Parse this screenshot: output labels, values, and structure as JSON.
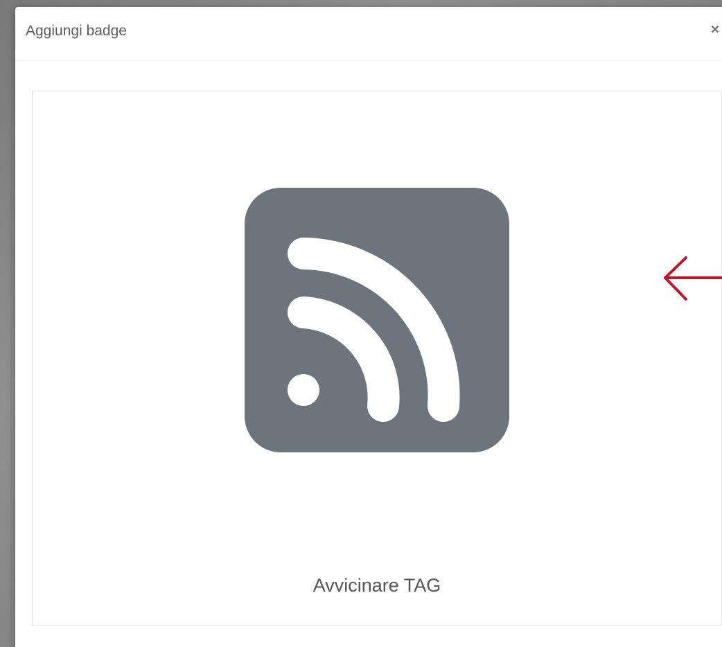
{
  "dialog": {
    "title": "Aggiungi badge",
    "close_label": "×"
  },
  "reader": {
    "icon": "rss-icon",
    "icon_color": "#6c757d",
    "label": "Avvicinare TAG"
  },
  "annotation": {
    "icon": "arrow-left-icon",
    "color": "#c0162c"
  }
}
